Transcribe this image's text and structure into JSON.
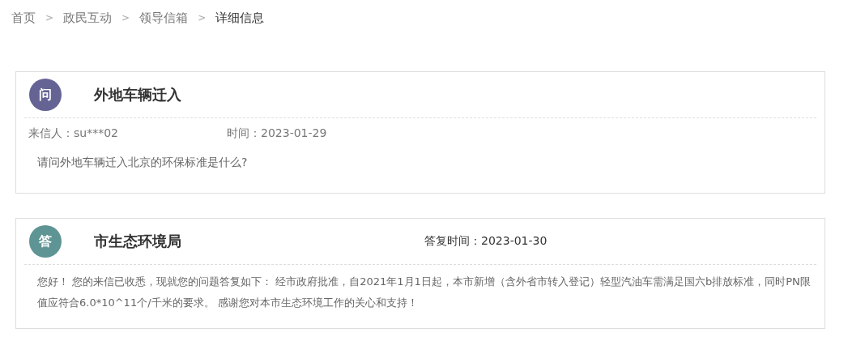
{
  "breadcrumb": [
    {
      "label": "首页",
      "selected": false
    },
    {
      "label": "政民互动",
      "selected": false
    },
    {
      "label": "领导信箱",
      "selected": false
    },
    {
      "label": "详细信息",
      "selected": true
    }
  ],
  "separator": ">",
  "question": {
    "badge": "问",
    "title": "外地车辆迁入",
    "sender_label": "来信人：",
    "sender": "su***02",
    "time_label": "时间：",
    "time": "2023-01-29",
    "body": "请问外地车辆迁入北京的环保标准是什么?"
  },
  "answer": {
    "badge": "答",
    "title": "市生态环境局",
    "time_label": "答复时间：",
    "time": "2023-01-30",
    "body": "您好！ 您的来信已收悉，现就您的问题答复如下： 经市政府批准，自2021年1月1日起，本市新增（含外省市转入登记）轻型汽油车需满足国六b排放标准，同时PN限值应符合6.0*10^11个/千米的要求。 感谢您对本市生态环境工作的关心和支持！"
  }
}
